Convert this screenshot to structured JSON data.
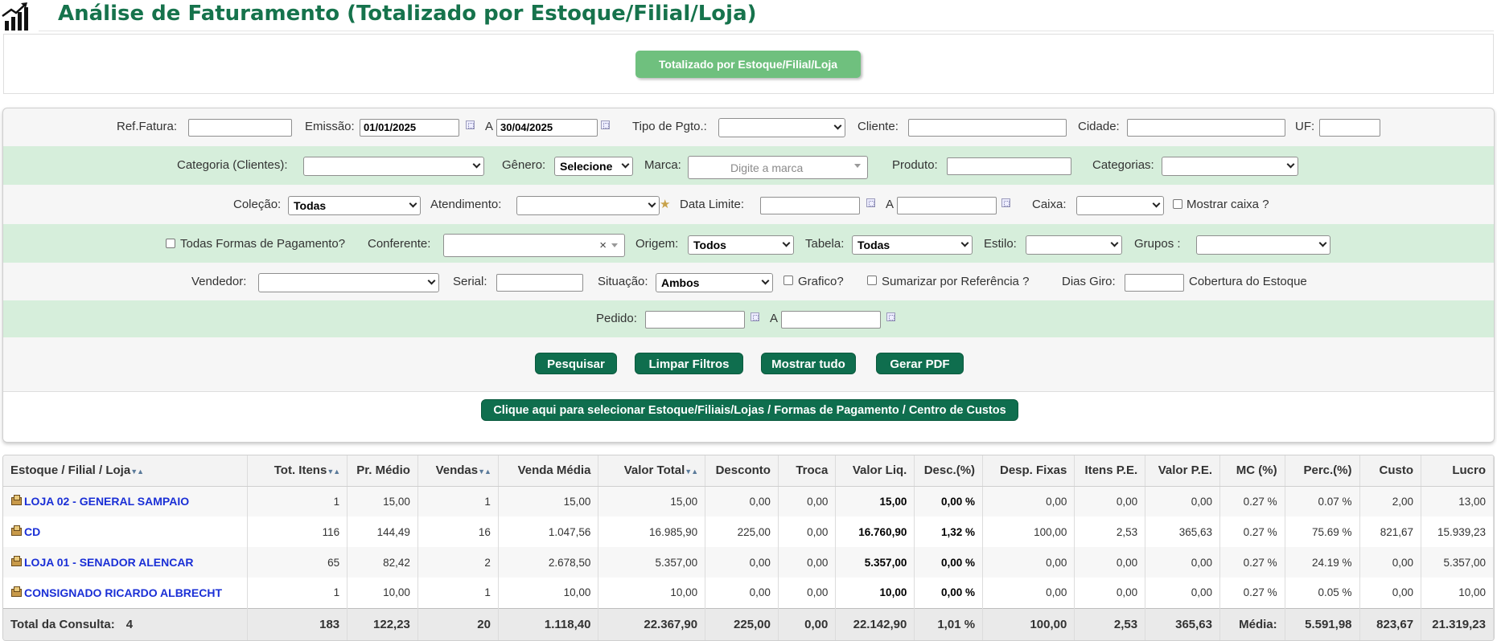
{
  "page": {
    "title": "Análise de Faturamento (Totalizado por Estoque/Filial/Loja)",
    "tab_button": "Totalizado por Estoque/Filial/Loja"
  },
  "filters": {
    "ref_fatura": {
      "label": "Ref.Fatura:",
      "value": ""
    },
    "emissao": {
      "label": "Emissão:",
      "from": "01/01/2025",
      "sep": "A",
      "to": "30/04/2025"
    },
    "tipo_pgto": {
      "label": "Tipo de Pgto.:",
      "value": ""
    },
    "cliente": {
      "label": "Cliente:",
      "value": ""
    },
    "cidade": {
      "label": "Cidade:",
      "value": ""
    },
    "uf": {
      "label": "UF:",
      "value": ""
    },
    "categoria_clientes": {
      "label": "Categoria (Clientes):",
      "value": ""
    },
    "genero": {
      "label": "Gênero:",
      "value": "Selecione"
    },
    "marca": {
      "label": "Marca:",
      "placeholder": "Digite a marca"
    },
    "produto": {
      "label": "Produto:",
      "value": ""
    },
    "categorias": {
      "label": "Categorias:",
      "value": ""
    },
    "colecao": {
      "label": "Coleção:",
      "value": "Todas"
    },
    "atendimento": {
      "label": "Atendimento:",
      "value": ""
    },
    "data_limite": {
      "label": "Data Limite:",
      "sep": "A",
      "from": "",
      "to": ""
    },
    "caixa": {
      "label": "Caixa:",
      "value": ""
    },
    "mostrar_caixa": {
      "label": "Mostrar caixa ?",
      "checked": false
    },
    "todas_formas": {
      "label": "Todas Formas de Pagamento?",
      "checked": false
    },
    "conferente": {
      "label": "Conferente:",
      "value": "",
      "clear": "×"
    },
    "origem": {
      "label": "Origem:",
      "value": "Todos"
    },
    "tabela": {
      "label": "Tabela:",
      "value": "Todas"
    },
    "estilo": {
      "label": "Estilo:",
      "value": ""
    },
    "grupos": {
      "label": "Grupos :",
      "value": ""
    },
    "vendedor": {
      "label": "Vendedor:",
      "value": ""
    },
    "serial": {
      "label": "Serial:",
      "value": ""
    },
    "situacao": {
      "label": "Situação:",
      "value": "Ambos"
    },
    "grafico": {
      "label": "Grafico?",
      "checked": false
    },
    "sumarizar": {
      "label": "Sumarizar por Referência ?",
      "checked": false
    },
    "dias_giro": {
      "label": "Dias Giro:",
      "value": "",
      "suffix": "Cobertura do Estoque"
    },
    "pedido": {
      "label": "Pedido:",
      "sep": "A",
      "from": "",
      "to": ""
    }
  },
  "actions": {
    "pesquisar": "Pesquisar",
    "limpar": "Limpar Filtros",
    "mostrar_tudo": "Mostrar tudo",
    "gerar_pdf": "Gerar PDF",
    "selecionar": "Clique aqui para selecionar Estoque/Filiais/Lojas / Formas de Pagamento / Centro de Custos"
  },
  "table": {
    "headers": [
      "Estoque / Filial / Loja",
      "Tot. Itens",
      "Pr. Médio",
      "Vendas",
      "Venda Média",
      "Valor Total",
      "Desconto",
      "Troca",
      "Valor Liq.",
      "Desc.(%)",
      "Desp. Fixas",
      "Itens P.E.",
      "Valor P.E.",
      "MC (%)",
      "Perc.(%)",
      "Custo",
      "Lucro"
    ],
    "sort_arrows": "▼▲",
    "rows": [
      [
        "LOJA 02 - GENERAL SAMPAIO",
        "1",
        "15,00",
        "1",
        "15,00",
        "15,00",
        "0,00",
        "0,00",
        "15,00",
        "0,00 %",
        "0,00",
        "0,00",
        "0,00",
        "0.27 %",
        "0.07 %",
        "2,00",
        "13,00"
      ],
      [
        "CD",
        "116",
        "144,49",
        "16",
        "1.047,56",
        "16.985,90",
        "225,00",
        "0,00",
        "16.760,90",
        "1,32 %",
        "100,00",
        "2,53",
        "365,63",
        "0.27 %",
        "75.69 %",
        "821,67",
        "15.939,23"
      ],
      [
        "LOJA 01 - SENADOR ALENCAR",
        "65",
        "82,42",
        "2",
        "2.678,50",
        "5.357,00",
        "0,00",
        "0,00",
        "5.357,00",
        "0,00 %",
        "0,00",
        "0,00",
        "0,00",
        "0.27 %",
        "24.19 %",
        "0,00",
        "5.357,00"
      ],
      [
        "CONSIGNADO RICARDO ALBRECHT",
        "1",
        "10,00",
        "1",
        "10,00",
        "10,00",
        "0,00",
        "0,00",
        "10,00",
        "0,00 %",
        "0,00",
        "0,00",
        "0,00",
        "0.27 %",
        "0.05 %",
        "0,00",
        "10,00"
      ]
    ],
    "total": [
      "Total da Consulta:",
      "4",
      "183",
      "122,23",
      "20",
      "1.118,40",
      "22.367,90",
      "225,00",
      "0,00",
      "22.142,90",
      "1,01 %",
      "100,00",
      "2,53",
      "365,63",
      "Média:",
      "5.591,98",
      "823,67",
      "21.319,23"
    ]
  }
}
